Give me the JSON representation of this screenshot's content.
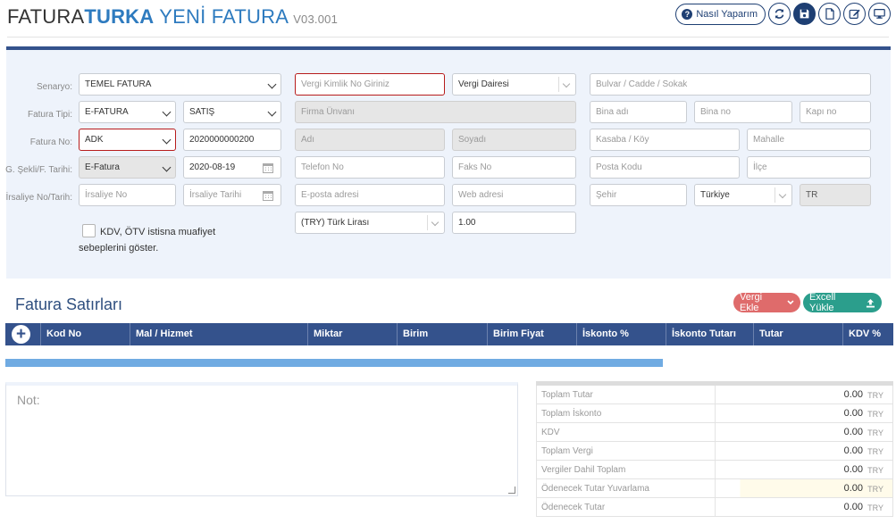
{
  "header": {
    "brand_part1": "FATURA",
    "brand_part2": "TURKA",
    "brand_part3": " YENİ FATURA",
    "version": "V03.001",
    "help_label": "Nasıl Yaparım",
    "icons": [
      "question-circle-icon",
      "refresh-icon",
      "save-icon",
      "new-document-icon",
      "edit-icon",
      "desktop-icon"
    ]
  },
  "labels": {
    "senaryo": "Senaryo:",
    "fatura_tipi": "Fatura Tipi:",
    "fatura_no": "Fatura No:",
    "g_sekli": "G. Şekli/F. Tarihi:",
    "irsaliye": "İrsaliye No/Tarih:"
  },
  "form": {
    "senaryo": "TEMEL FATURA",
    "fatura_tipi": "E-FATURA",
    "satis": "SATIŞ",
    "fatura_prefix": "ADK",
    "fatura_no": "2020000000200",
    "gonderim_sekli": "E-Fatura",
    "fatura_tarihi": "2020-08-19",
    "irsaliye_no_ph": "İrsaliye No",
    "irsaliye_tarihi_ph": "İrsaliye Tarihi",
    "vkn_ph": "Vergi Kimlik No Giriniz",
    "vergi_dairesi": "Vergi Dairesi",
    "firma_unvani_ph": "Firma Ünvanı",
    "adi_ph": "Adı",
    "soyadi_ph": "Soyadı",
    "telefon_ph": "Telefon No",
    "faks_ph": "Faks No",
    "eposta_ph": "E-posta adresi",
    "web_ph": "Web adresi",
    "doviz": "(TRY) Türk Lirası",
    "kur": "1.00",
    "bulvar_ph": "Bulvar / Cadde / Sokak",
    "bina_adi_ph": "Bina adı",
    "bina_no_ph": "Bina no",
    "kapi_no_ph": "Kapı no",
    "kasaba_ph": "Kasaba / Köy",
    "mahalle_ph": "Mahalle",
    "posta_kodu_ph": "Posta Kodu",
    "ilce_ph": "İlçe",
    "sehir_ph": "Şehir",
    "ulke": "Türkiye",
    "ulke_kodu": "TR",
    "kdv_checkbox_label": "KDV, ÖTV istisna muafiyet sebeplerini göster."
  },
  "lines": {
    "title": "Fatura Satırları",
    "vergi_ekle": "Vergi Ekle",
    "excel_yukle": "Excell Yükle",
    "columns": [
      "Kod No",
      "Mal / Hizmet",
      "Miktar",
      "Birim",
      "Birim Fiyat",
      "İskonto %",
      "İskonto Tutarı",
      "Tutar",
      "KDV %"
    ],
    "progress_fraction": 0.74
  },
  "note": {
    "label": "Not:"
  },
  "totals": {
    "currency": "TRY",
    "rows": [
      {
        "label": "Toplam Tutar",
        "value": "0.00"
      },
      {
        "label": "Toplam İskonto",
        "value": "0.00"
      },
      {
        "label": "KDV",
        "value": "0.00"
      },
      {
        "label": "Toplam Vergi",
        "value": "0.00"
      },
      {
        "label": "Vergiler Dahil Toplam",
        "value": "0.00"
      },
      {
        "label": "Ödenecek Tutar Yuvarlama",
        "value": "0.00"
      },
      {
        "label": "Ödenecek Tutar",
        "value": "0.00"
      }
    ]
  },
  "colors": {
    "navy": "#34528c",
    "accent_blue": "#2e7bbf",
    "error_red": "#b71c1c",
    "pill_red": "#df6b6b",
    "pill_green": "#2b9e8c",
    "progress": "#70abe2"
  }
}
